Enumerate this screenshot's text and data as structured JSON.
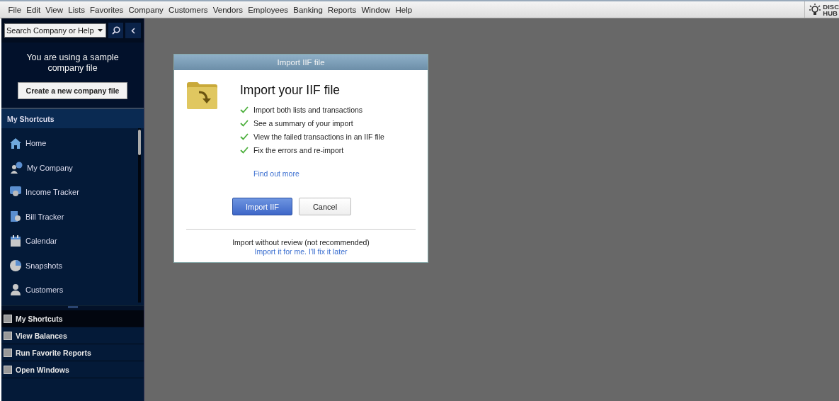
{
  "menu_bar": {
    "items": [
      "File",
      "Edit",
      "View",
      "Lists",
      "Favorites",
      "Company",
      "Customers",
      "Vendors",
      "Employees",
      "Banking",
      "Reports",
      "Window",
      "Help"
    ],
    "discover_hub": {
      "line_1": "DISC",
      "line_2": "HUB"
    }
  },
  "sidebar": {
    "search": {
      "placeholder": "Search Company or Help"
    },
    "sample_notice": {
      "text": "You are using a sample company file",
      "button": "Create a new company file"
    },
    "shortcuts_header": "My Shortcuts",
    "shortcuts": [
      {
        "label": "Home",
        "kind": "home"
      },
      {
        "label": "My Company",
        "kind": "company"
      },
      {
        "label": "Income Tracker",
        "kind": "income"
      },
      {
        "label": "Bill Tracker",
        "kind": "bill"
      },
      {
        "label": "Calendar",
        "kind": "calendar"
      },
      {
        "label": "Snapshots",
        "kind": "snapshots"
      },
      {
        "label": "Customers",
        "kind": "customers"
      }
    ],
    "nav_tabs": [
      {
        "label": "My Shortcuts",
        "selected": true
      },
      {
        "label": "View Balances",
        "selected": false
      },
      {
        "label": "Run Favorite Reports",
        "selected": false
      },
      {
        "label": "Open Windows",
        "selected": false
      }
    ]
  },
  "dialog": {
    "title": "Import IIF file",
    "heading": "Import your IIF file",
    "features": [
      "Import both lists and transactions",
      "See a summary of your import",
      "View the failed transactions in an IIF file",
      "Fix the errors and re-import"
    ],
    "link": "Find out more",
    "buttons": [
      {
        "label": "Import IIF",
        "kind": "primary"
      },
      {
        "label": "Cancel",
        "kind": "secondary"
      }
    ],
    "footer_note": "Import without review (not recommended)",
    "footer_link": "Import it for me. I'll fix it later"
  }
}
